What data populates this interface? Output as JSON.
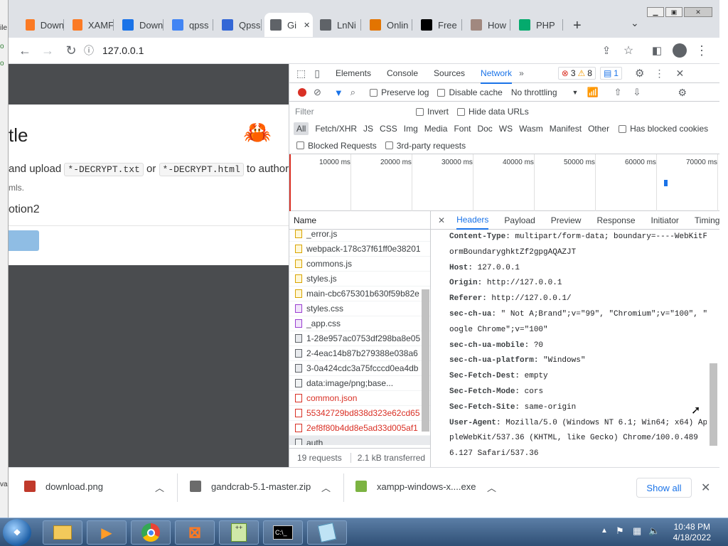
{
  "desktop_left": [
    "ile",
    "o",
    "o",
    "va"
  ],
  "tabs": [
    {
      "label": "Down",
      "icon": "xampp-icon",
      "color": "#fb7a24"
    },
    {
      "label": "XAMF",
      "icon": "xampp-icon",
      "color": "#fb7a24"
    },
    {
      "label": "Down",
      "icon": "download-icon",
      "color": "#1a73e8"
    },
    {
      "label": "qpss",
      "icon": "google-icon",
      "color": "#4285f4"
    },
    {
      "label": "Qpss",
      "icon": "qpss-icon",
      "color": "#3367d6"
    },
    {
      "label": "Gi",
      "icon": "globe-icon",
      "color": "#5f6368"
    },
    {
      "label": "LnNi",
      "icon": "globe-icon",
      "color": "#5f6368"
    },
    {
      "label": "Onlin",
      "icon": "anchor-icon",
      "color": "#e37400"
    },
    {
      "label": "Free",
      "icon": "ff-icon",
      "color": "#000000"
    },
    {
      "label": "How",
      "icon": "person-icon",
      "color": "#a1887f"
    },
    {
      "label": "PHP",
      "icon": "w3-icon",
      "color": "#04aa6d"
    }
  ],
  "toolbar": {
    "url": "127.0.0.1"
  },
  "page": {
    "title_fragment": "tle",
    "instruction_pre": "and upload",
    "code1": "*-DECRYPT.txt",
    "or": "or",
    "code2": "*-DECRYPT.html",
    "instruction_post": "to author",
    "small": "mls.",
    "option": "otion2"
  },
  "devtools": {
    "tabs": [
      "Elements",
      "Console",
      "Sources",
      "Network"
    ],
    "errors": "3",
    "warnings": "8",
    "messages": "1",
    "preserve_log": "Preserve log",
    "disable_cache": "Disable cache",
    "throttling": "No throttling",
    "filter_placeholder": "Filter",
    "invert": "Invert",
    "hide_data_urls": "Hide data URLs",
    "types": [
      "All",
      "Fetch/XHR",
      "JS",
      "CSS",
      "Img",
      "Media",
      "Font",
      "Doc",
      "WS",
      "Wasm",
      "Manifest",
      "Other"
    ],
    "has_blocked_cookies": "Has blocked cookies",
    "blocked_requests": "Blocked Requests",
    "third_party": "3rd-party requests",
    "timeline_labels": [
      "10000 ms",
      "20000 ms",
      "30000 ms",
      "40000 ms",
      "50000 ms",
      "60000 ms",
      "70000 ms"
    ],
    "name_header": "Name",
    "requests": [
      {
        "name": "_error.js",
        "kind": "js"
      },
      {
        "name": "webpack-178c37f61ff0e38201",
        "kind": "js"
      },
      {
        "name": "commons.js",
        "kind": "js"
      },
      {
        "name": "styles.js",
        "kind": "js"
      },
      {
        "name": "main-cbc675301b630f59b82e",
        "kind": "js"
      },
      {
        "name": "styles.css",
        "kind": "css"
      },
      {
        "name": "_app.css",
        "kind": "css"
      },
      {
        "name": "1-28e957ac0753df298ba8e05",
        "kind": "img"
      },
      {
        "name": "2-4eac14b87b279388e038a6",
        "kind": "img"
      },
      {
        "name": "3-0a424cdc3a75fcccd0ea4db",
        "kind": "img"
      },
      {
        "name": "data:image/png;base...",
        "kind": "gray"
      },
      {
        "name": "common.json",
        "kind": "red"
      },
      {
        "name": "55342729bd838d323e62cd65",
        "kind": "red"
      },
      {
        "name": "2ef8f80b4dd8e5ad33d005af1",
        "kind": "red"
      },
      {
        "name": "auth",
        "kind": "gray"
      }
    ],
    "summary_requests": "19 requests",
    "summary_transferred": "2.1 kB transferred",
    "detail_tabs": [
      "Headers",
      "Payload",
      "Preview",
      "Response",
      "Initiator",
      "Timing"
    ],
    "headers": [
      {
        "k": "Content-Type:",
        "v": "multipart/form-data; boundary=----WebKitF"
      },
      {
        "k": "",
        "v": "ormBoundaryghktZf2gpgAQAZJT"
      },
      {
        "k": "Host:",
        "v": "127.0.0.1"
      },
      {
        "k": "Origin:",
        "v": "http://127.0.0.1"
      },
      {
        "k": "Referer:",
        "v": "http://127.0.0.1/"
      },
      {
        "k": "sec-ch-ua:",
        "v": "\" Not A;Brand\";v=\"99\", \"Chromium\";v=\"100\", \"G"
      },
      {
        "k": "",
        "v": "oogle Chrome\";v=\"100\""
      },
      {
        "k": "sec-ch-ua-mobile:",
        "v": "?0"
      },
      {
        "k": "sec-ch-ua-platform:",
        "v": "\"Windows\""
      },
      {
        "k": "Sec-Fetch-Dest:",
        "v": "empty"
      },
      {
        "k": "Sec-Fetch-Mode:",
        "v": "cors"
      },
      {
        "k": "Sec-Fetch-Site:",
        "v": "same-origin"
      },
      {
        "k": "User-Agent:",
        "v": "Mozilla/5.0 (Windows NT 6.1; Win64; x64) Ap"
      },
      {
        "k": "",
        "v": "pleWebKit/537.36 (KHTML, like Gecko) Chrome/100.0.489"
      },
      {
        "k": "",
        "v": "6.127 Safari/537.36"
      }
    ]
  },
  "downloads": {
    "items": [
      {
        "name": "download.png",
        "color": "#c0392b"
      },
      {
        "name": "gandcrab-5.1-master.zip",
        "color": "#6b6b6b"
      },
      {
        "name": "xampp-windows-x....exe",
        "color": "#7cb342"
      }
    ],
    "show_all": "Show all"
  },
  "taskbar": {
    "time": "10:48 PM",
    "date": "4/18/2022"
  }
}
